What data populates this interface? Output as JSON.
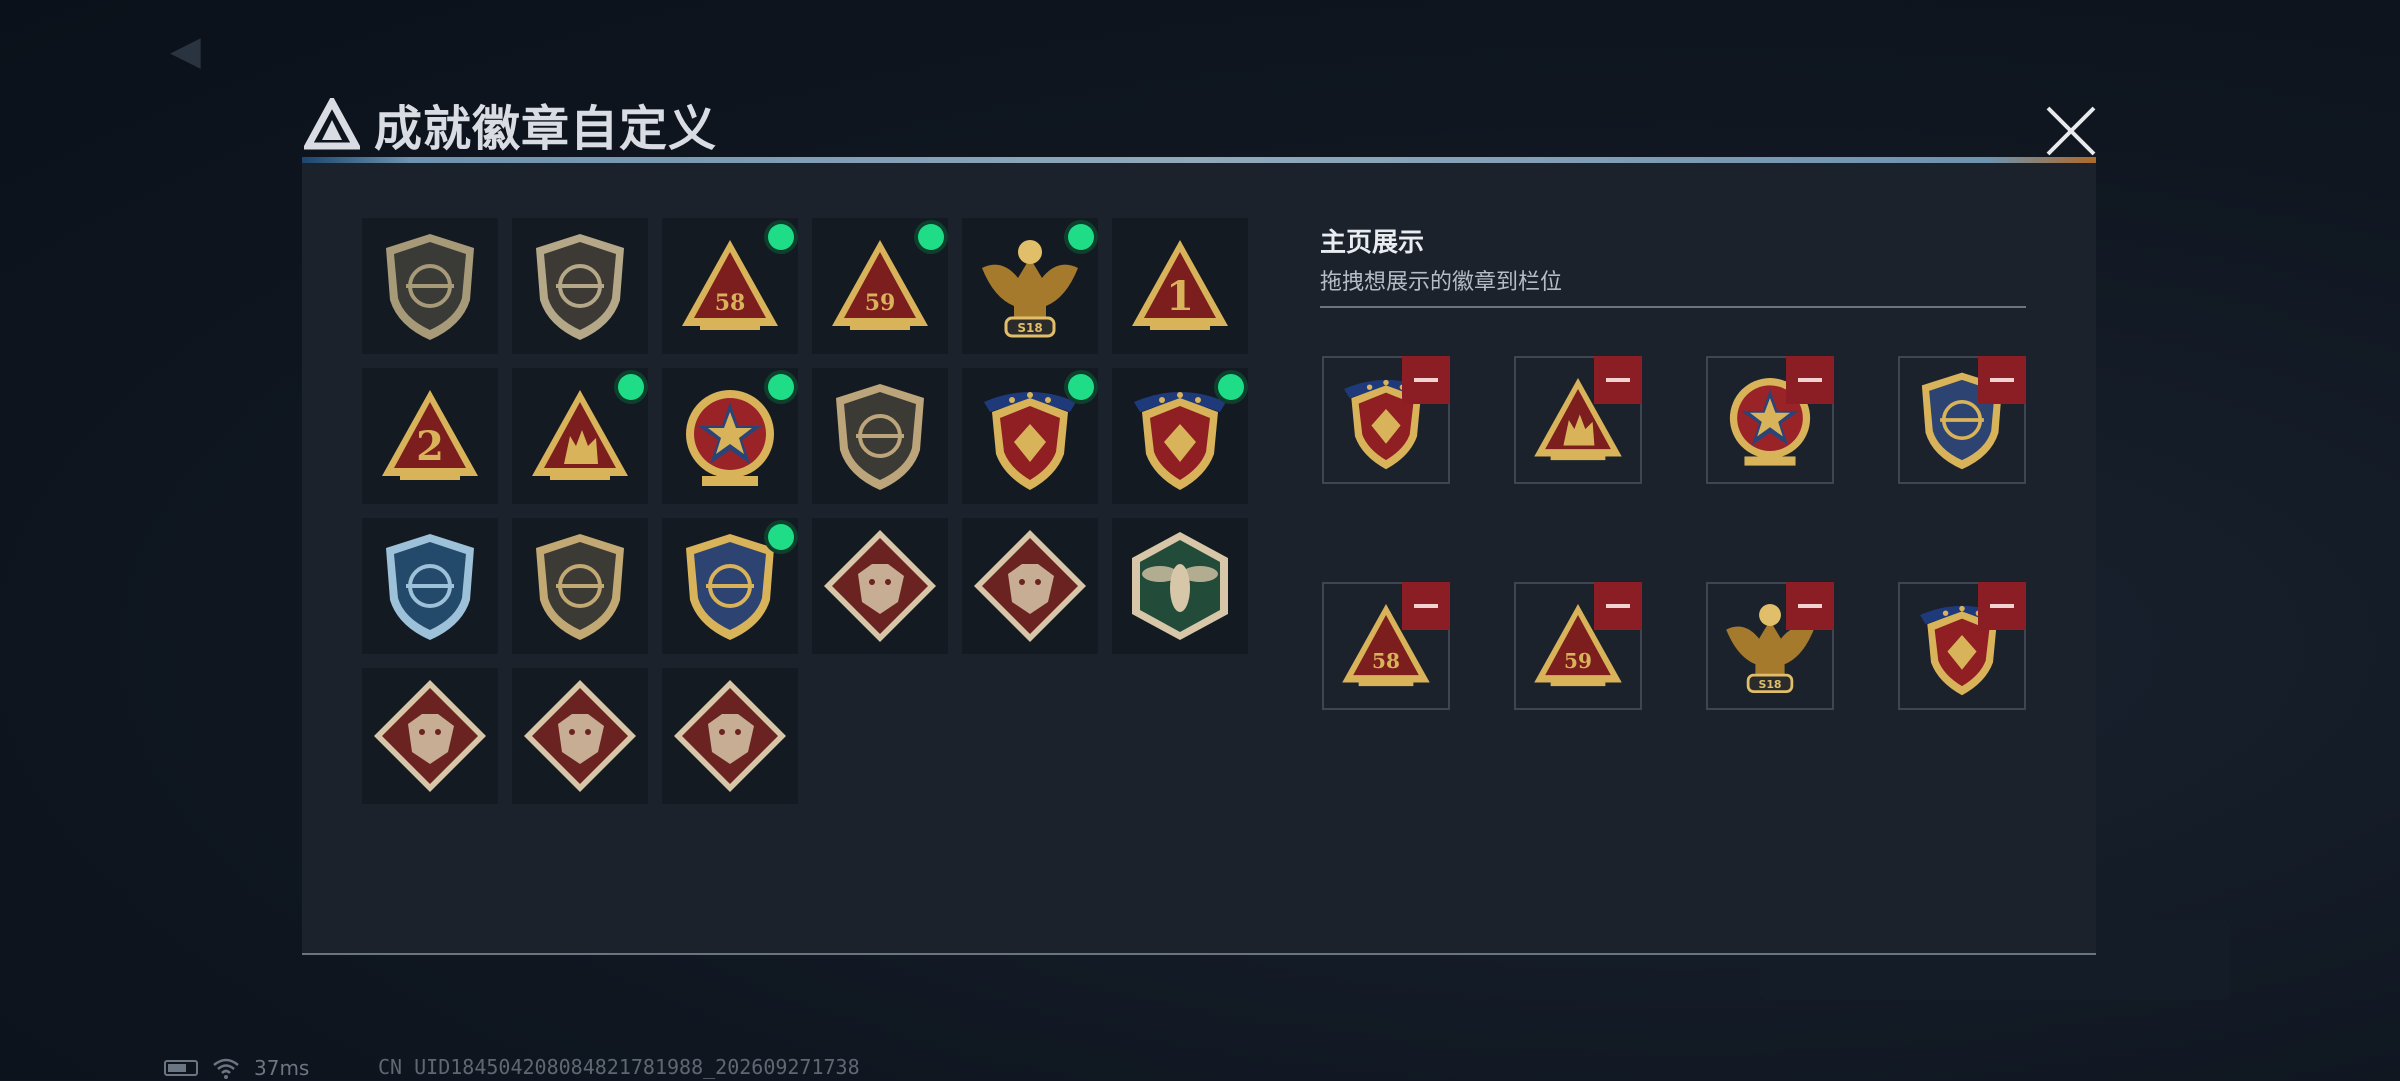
{
  "modal": {
    "title": "成就徽章自定义"
  },
  "badges": [
    {
      "icon": "shield-delta-icon",
      "type": "shield",
      "fill": "#3a3a36",
      "accent": "#a79a78",
      "new": false
    },
    {
      "icon": "helicopter-shield-icon",
      "type": "shield",
      "fill": "#3d3a35",
      "accent": "#b4a888",
      "new": false
    },
    {
      "icon": "triangle-58-badge-icon",
      "type": "triangle",
      "fill": "#7c1e1e",
      "accent": "#d9b35a",
      "glyph": "58",
      "new": true
    },
    {
      "icon": "triangle-winged-59-badge-icon",
      "type": "triangle",
      "fill": "#7c1e1e",
      "accent": "#d9b35a",
      "glyph": "59",
      "new": true
    },
    {
      "icon": "eagle-s18-badge-icon",
      "type": "eagle",
      "fill": "#a67a2c",
      "accent": "#e1bf6a",
      "glyph": "S18",
      "new": true
    },
    {
      "icon": "triangle-1-badge-icon",
      "type": "triangle",
      "fill": "#7c1e1e",
      "accent": "#d9b35a",
      "glyph": "1",
      "new": false
    },
    {
      "icon": "triangle-2-badge-icon",
      "type": "triangle",
      "fill": "#7c1e1e",
      "accent": "#d9b35a",
      "glyph": "2",
      "new": false
    },
    {
      "icon": "triangle-soldiers-badge-icon",
      "type": "triangle",
      "fill": "#7c1e1e",
      "accent": "#d9b35a",
      "glyph": "",
      "new": true
    },
    {
      "icon": "star-medal-badge-icon",
      "type": "round",
      "fill": "#9a2328",
      "accent": "#d9b35a",
      "new": true
    },
    {
      "icon": "small-shield-emblem-icon",
      "type": "shield",
      "fill": "#3b3a35",
      "accent": "#bca57a",
      "new": false
    },
    {
      "icon": "winged-shield-gold-badge-icon",
      "type": "shieldstars",
      "fill": "#8f1f22",
      "accent": "#d9b35a",
      "new": true
    },
    {
      "icon": "gem-shield-badge-icon",
      "type": "shieldstars",
      "fill": "#8f1f22",
      "accent": "#d9b35a",
      "new": true
    },
    {
      "icon": "crosshair-rifle-shield-icon",
      "type": "shield",
      "fill": "#234a6b",
      "accent": "#9cc1d9",
      "new": false
    },
    {
      "icon": "rifle-shield-icon",
      "type": "shield",
      "fill": "#3b3a35",
      "accent": "#c2a872",
      "new": false
    },
    {
      "icon": "crossed-weapons-gold-shield-icon",
      "type": "shield",
      "fill": "#2d4372",
      "accent": "#d9b35a",
      "new": true
    },
    {
      "icon": "wolf-diamond-badge-icon",
      "type": "diamond",
      "fill": "#6a2320",
      "accent": "#d7c6a8",
      "new": false
    },
    {
      "icon": "wolf-diamond-badge-alt-icon",
      "type": "diamond",
      "fill": "#6a2320",
      "accent": "#d7c6a8",
      "new": false
    },
    {
      "icon": "wasp-hexagon-badge-icon",
      "type": "hexagon",
      "fill": "#224b3a",
      "accent": "#d7c6a8",
      "new": false
    },
    {
      "icon": "dragon-diamond-badge-icon",
      "type": "diamond",
      "fill": "#6a2320",
      "accent": "#d7c6a8",
      "new": false
    },
    {
      "icon": "dragon-diamond-badge-alt-icon",
      "type": "diamond",
      "fill": "#6a2320",
      "accent": "#d7c6a8",
      "new": false
    },
    {
      "icon": "runner-diamond-badge-icon",
      "type": "diamond",
      "fill": "#6a2320",
      "accent": "#d7c6a8",
      "new": false
    }
  ],
  "showcase": {
    "title": "主页展示",
    "subtitle": "拖拽想展示的徽章到栏位",
    "slots": [
      {
        "icon": "winged-shield-gold-badge-icon",
        "type": "shieldstars",
        "fill": "#8f1f22",
        "accent": "#d9b35a"
      },
      {
        "icon": "triangle-soldiers-badge-icon",
        "type": "triangle",
        "fill": "#7c1e1e",
        "accent": "#d9b35a",
        "glyph": ""
      },
      {
        "icon": "star-medal-badge-icon",
        "type": "round",
        "fill": "#9a2328",
        "accent": "#d9b35a"
      },
      {
        "icon": "crossed-weapons-gold-shield-icon",
        "type": "shield",
        "fill": "#2d4372",
        "accent": "#d9b35a"
      },
      {
        "icon": "triangle-58-badge-icon",
        "type": "triangle",
        "fill": "#7c1e1e",
        "accent": "#d9b35a",
        "glyph": "58"
      },
      {
        "icon": "triangle-winged-59-badge-icon",
        "type": "triangle",
        "fill": "#7c1e1e",
        "accent": "#d9b35a",
        "glyph": "59"
      },
      {
        "icon": "eagle-s18-badge-icon",
        "type": "eagle",
        "fill": "#a67a2c",
        "accent": "#e1bf6a",
        "glyph": "S18"
      },
      {
        "icon": "gem-shield-badge-icon",
        "type": "shieldstars",
        "fill": "#8f1f22",
        "accent": "#d9b35a"
      }
    ]
  },
  "status": {
    "ping": "37ms",
    "uid": "CN UID184504208084821781988_202609271738"
  },
  "colors": {
    "new_dot": "#1fdc86",
    "remove": "#8b1d25"
  }
}
